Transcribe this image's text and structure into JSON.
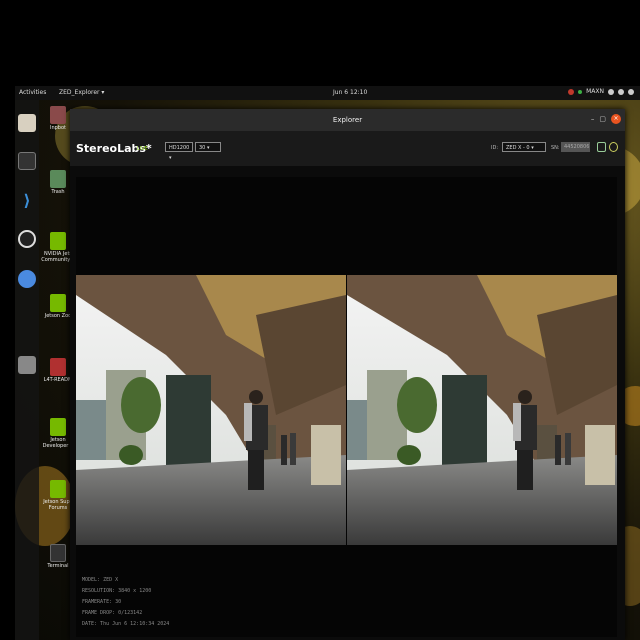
{
  "topbar": {
    "activities": "Activities",
    "app_menu": "ZED_Explorer ▾",
    "clock": "Jun 6 12:10",
    "tray_label": "MAXN"
  },
  "desktop_icons": [
    {
      "label": "Inpbot",
      "color": "#8a4a4a"
    },
    {
      "label": "Trash",
      "color": "#5a8a5a"
    },
    {
      "label": "NVIDIA Jets Community F",
      "color": "#76b900"
    },
    {
      "label": "Jetson Zoo",
      "color": "#76b900"
    },
    {
      "label": "L4T-READM",
      "color": "#b03030"
    },
    {
      "label": "Jetson Developer Z",
      "color": "#76b900"
    },
    {
      "label": "Jetson Supp Forums",
      "color": "#76b900"
    },
    {
      "label": "Terminal",
      "color": "#333"
    }
  ],
  "window": {
    "title": "Explorer",
    "minimize_glyph": "–",
    "maximize_glyph": "▢",
    "close_glyph": "×"
  },
  "appbar": {
    "logo": "StereoLabs*",
    "live": "LIVE",
    "resolution_select": "HD1200 ▾",
    "fps_select": "30 ▾",
    "id_label": "ID:",
    "camera_select": "ZED X - 0 ▾",
    "sn_label": "SN:",
    "sn_value": "44520806"
  },
  "info": {
    "model": "MODEL: ZED X",
    "resolution": "RESOLUTION: 3840 x 1200",
    "framerate": "FRAMERATE: 30",
    "frame_drop": "FRAME DROP: 0/123142",
    "date": "DATE: Thu Jun 6 12:10:34 2024"
  },
  "colors": {
    "accent_live": "#76b900",
    "close_button": "#e95420",
    "nvidia": "#76b900"
  }
}
